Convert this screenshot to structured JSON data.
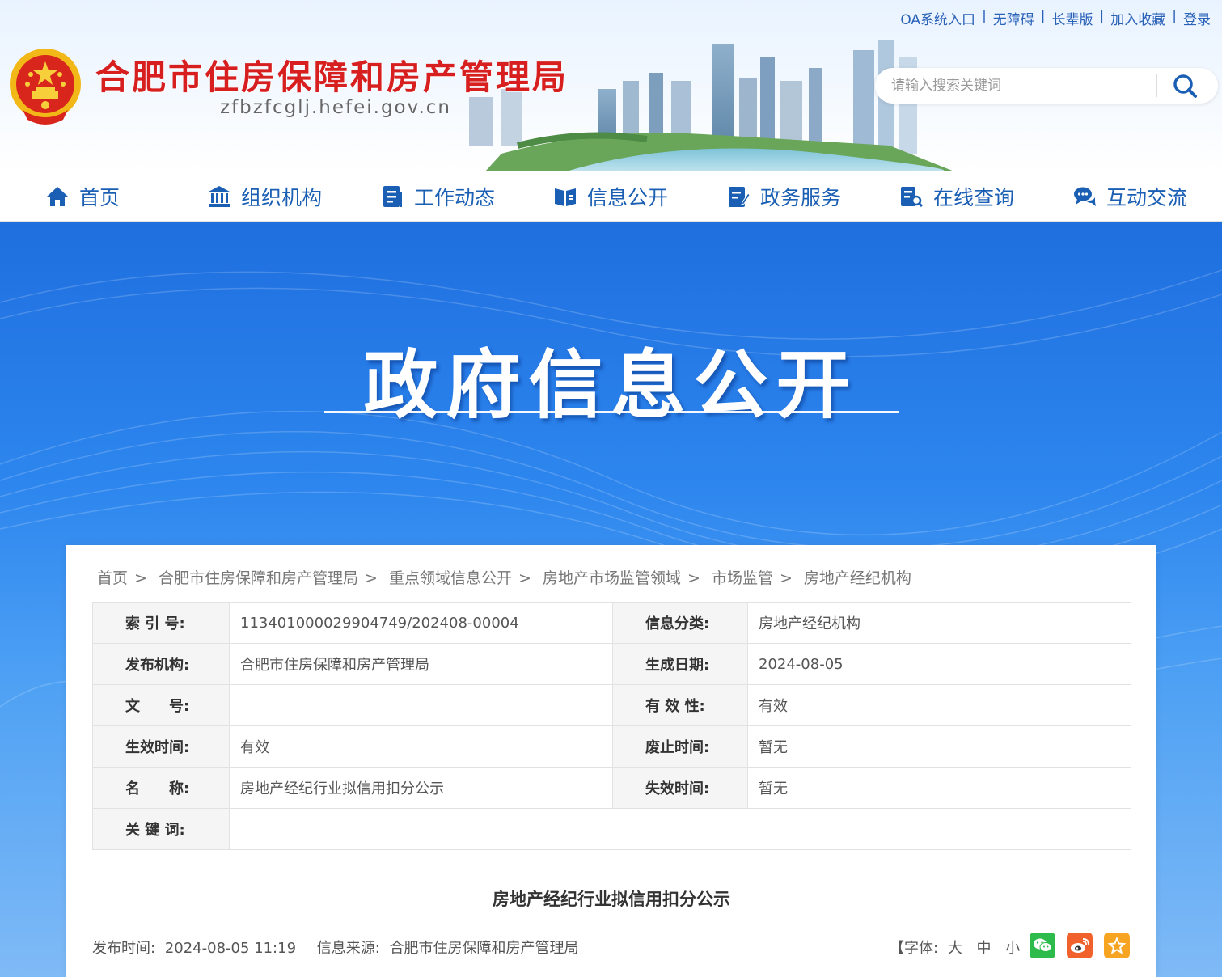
{
  "header": {
    "site_title": "合肥市住房保障和房产管理局",
    "site_domain": "zfbzfcglj.hefei.gov.cn",
    "top_links": [
      "OA系统入口",
      "无障碍",
      "长辈版",
      "加入收藏",
      "登录"
    ],
    "search_placeholder": "请输入搜索关键词"
  },
  "nav": {
    "items": [
      {
        "label": "首页",
        "icon": "home-icon"
      },
      {
        "label": "组织机构",
        "icon": "building-icon"
      },
      {
        "label": "工作动态",
        "icon": "document-icon"
      },
      {
        "label": "信息公开",
        "icon": "open-book-icon"
      },
      {
        "label": "政务服务",
        "icon": "edit-form-icon"
      },
      {
        "label": "在线查询",
        "icon": "search-doc-icon"
      },
      {
        "label": "互动交流",
        "icon": "chat-icon"
      }
    ]
  },
  "banner": {
    "title": "政府信息公开"
  },
  "breadcrumb": [
    "首页",
    "合肥市住房保障和房产管理局",
    "重点领域信息公开",
    "房地产市场监管领域",
    "市场监管",
    "房地产经纪机构"
  ],
  "meta": {
    "rows": [
      {
        "k1": "索 引 号:",
        "v1": "113401000029904749/202408-00004",
        "k2": "信息分类:",
        "v2": "房地产经纪机构"
      },
      {
        "k1": "发布机构:",
        "v1": "合肥市住房保障和房产管理局",
        "k2": "生成日期:",
        "v2": "2024-08-05"
      },
      {
        "k1": "文　　号:",
        "v1": "",
        "k2": "有 效 性:",
        "v2": "有效"
      },
      {
        "k1": "生效时间:",
        "v1": "有效",
        "k2": "废止时间:",
        "v2": "暂无"
      },
      {
        "k1": "名　　称:",
        "v1": "房地产经纪行业拟信用扣分公示",
        "k2": "失效时间:",
        "v2": "暂无"
      }
    ],
    "keyword_label": "关 键 词:",
    "keyword_value": ""
  },
  "article": {
    "title": "房地产经纪行业拟信用扣分公示",
    "publish_label": "发布时间:",
    "publish_time": "2024-08-05 11:19",
    "source_label": "信息来源:",
    "source": "合肥市住房保障和房产管理局",
    "font_label": "【字体:",
    "font_sizes": [
      "大",
      "中",
      "小"
    ],
    "font_close": "】"
  },
  "colors": {
    "title_red": "#d71f1f",
    "nav_blue": "#1a5fb4",
    "wechat": "#2dbb4b",
    "weibo": "#f0612c",
    "favorite": "#f7a423"
  }
}
